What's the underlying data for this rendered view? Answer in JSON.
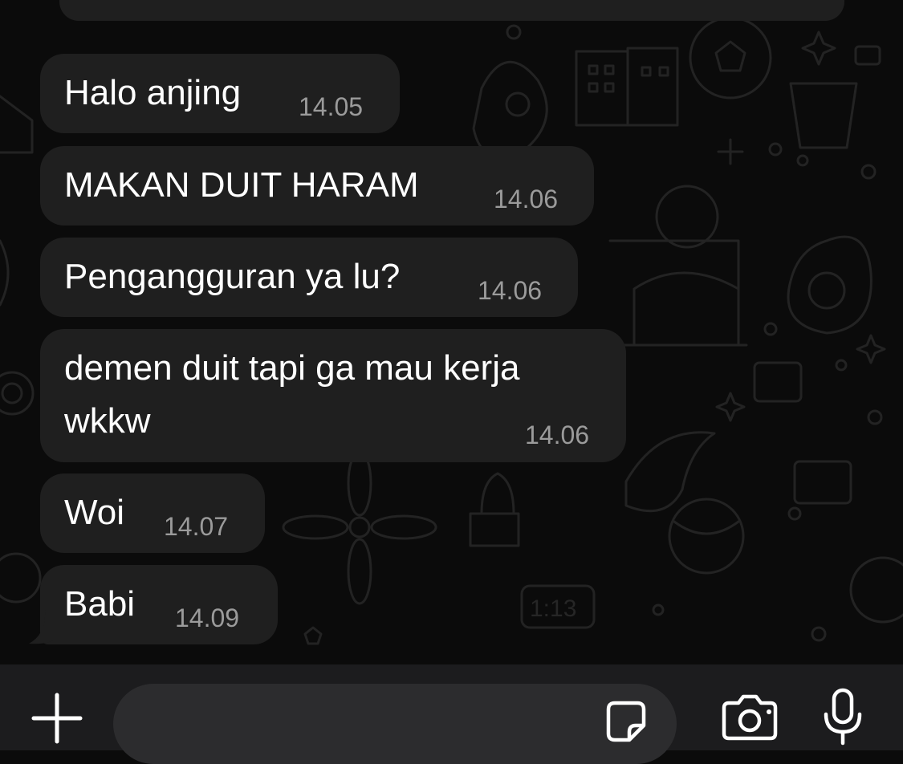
{
  "messages": [
    {
      "text": "Halo anjing",
      "time": "14.05"
    },
    {
      "text": "MAKAN DUIT HARAM",
      "time": "14.06"
    },
    {
      "text": "Pengangguran ya lu?",
      "time": "14.06"
    },
    {
      "text": "demen duit tapi ga mau kerja",
      "text2": "wkkw",
      "time": "14.06"
    },
    {
      "text": "Woi",
      "time": "14.07"
    },
    {
      "text": "Babi",
      "time": "14.09"
    }
  ],
  "input": {
    "value": "",
    "placeholder": ""
  },
  "icons": {
    "attach": "plus-icon",
    "sticker": "sticker-icon",
    "camera": "camera-icon",
    "mic": "microphone-icon"
  },
  "colors": {
    "background": "#0b0b0b",
    "bubble": "#1f1f1f",
    "timestamp": "#9b9b9b",
    "input_bar": "#1c1c1e",
    "input_field": "#2c2c2e"
  }
}
